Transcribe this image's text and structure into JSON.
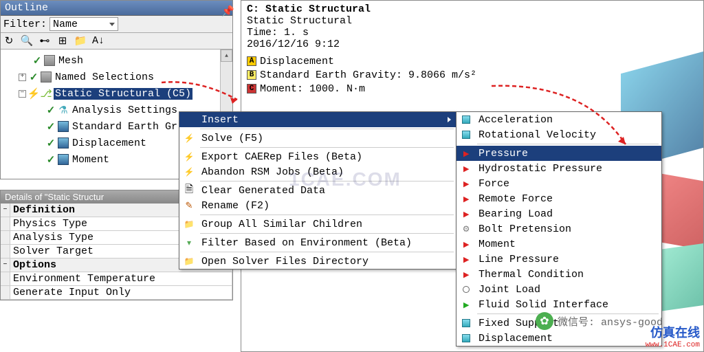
{
  "outline": {
    "title": "Outline",
    "filter_label": "Filter:",
    "filter_value": "Name",
    "tree": {
      "mesh": "Mesh",
      "named_selections": "Named Selections",
      "static_structural": "Static Structural (C5)",
      "analysis_settings": "Analysis Settings",
      "earth_gravity": "Standard Earth Gr",
      "displacement": "Displacement",
      "moment": "Moment"
    }
  },
  "details": {
    "title": "Details of \"Static Structur",
    "definition": "Definition",
    "physics_type": "Physics Type",
    "analysis_type": "Analysis Type",
    "solver_target": "Solver Target",
    "options": "Options",
    "env_temp": "Environment Temperature",
    "gen_input": "Generate Input Only"
  },
  "main": {
    "title": "C: Static Structural",
    "subtitle": "Static Structural",
    "time": "Time: 1. s",
    "date": "2016/12/16 9:12",
    "legend_a": "Displacement",
    "legend_b": "Standard Earth Gravity: 9.8066 m/s²",
    "legend_c": "Moment: 1000. N·m"
  },
  "menu1": {
    "insert": "Insert",
    "solve": "Solve (F5)",
    "export_caerep": "Export CAERep Files (Beta)",
    "abandon_rsm": "Abandon RSM Jobs (Beta)",
    "clear_data": "Clear Generated Data",
    "rename": "Rename (F2)",
    "group_children": "Group All Similar Children",
    "filter_env": "Filter Based on Environment (Beta)",
    "open_solver": "Open Solver Files Directory"
  },
  "menu2": {
    "acceleration": "Acceleration",
    "rot_velocity": "Rotational Velocity",
    "pressure": "Pressure",
    "hydro_pressure": "Hydrostatic Pressure",
    "force": "Force",
    "remote_force": "Remote Force",
    "bearing_load": "Bearing Load",
    "bolt_pretension": "Bolt Pretension",
    "moment": "Moment",
    "line_pressure": "Line Pressure",
    "thermal": "Thermal Condition",
    "joint_load": "Joint Load",
    "fluid_solid": "Fluid Solid Interface",
    "fixed_support": "Fixed Support",
    "displacement": "Displacement"
  },
  "wechat": "微信号: ansys-good",
  "brand": "仿真在线",
  "url": "www.1CAE.com"
}
